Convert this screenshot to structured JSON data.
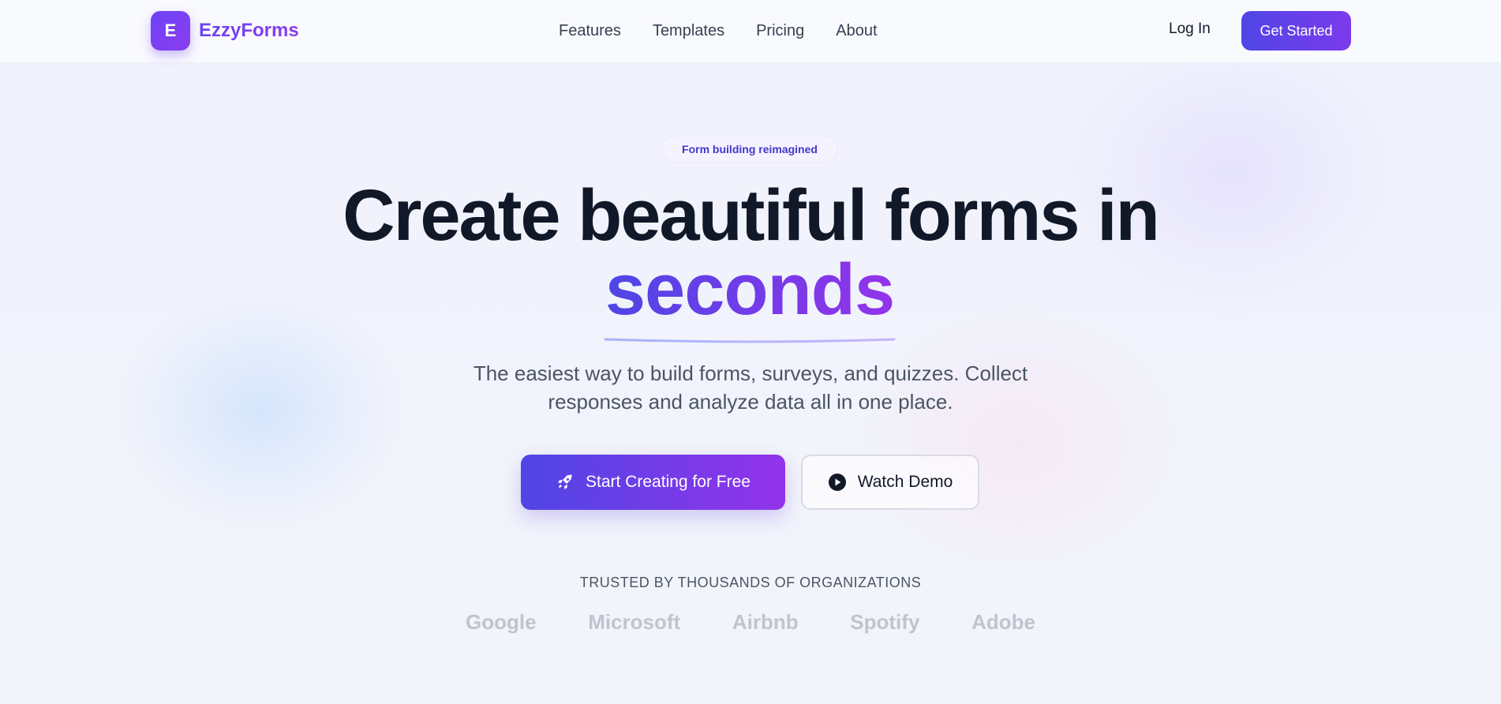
{
  "brand": {
    "mark": "E",
    "name": "EzzyForms"
  },
  "nav": {
    "items": [
      {
        "label": "Features"
      },
      {
        "label": "Templates"
      },
      {
        "label": "Pricing"
      },
      {
        "label": "About"
      }
    ],
    "login_label": "Log In",
    "get_started_label": "Get Started"
  },
  "hero": {
    "badge": "Form building reimagined",
    "headline": "Create beautiful forms in",
    "headline_accent": "seconds",
    "subtitle": "The easiest way to build forms, surveys, and quizzes. Collect responses and analyze data all in one place.",
    "primary_cta": {
      "label": "Start Creating for Free",
      "icon": "rocket-icon"
    },
    "secondary_cta": {
      "label": "Watch Demo",
      "icon": "play-circle-icon"
    }
  },
  "trusted": {
    "heading": "TRUSTED BY THOUSANDS OF ORGANIZATIONS",
    "companies": [
      "Google",
      "Microsoft",
      "Airbnb",
      "Spotify",
      "Adobe"
    ]
  },
  "colors": {
    "accent_start": "#4f46e5",
    "accent_end": "#9333ea",
    "text_dark": "#111827",
    "text_muted": "#4b5563",
    "logo_gray": "#c0c4cf"
  }
}
